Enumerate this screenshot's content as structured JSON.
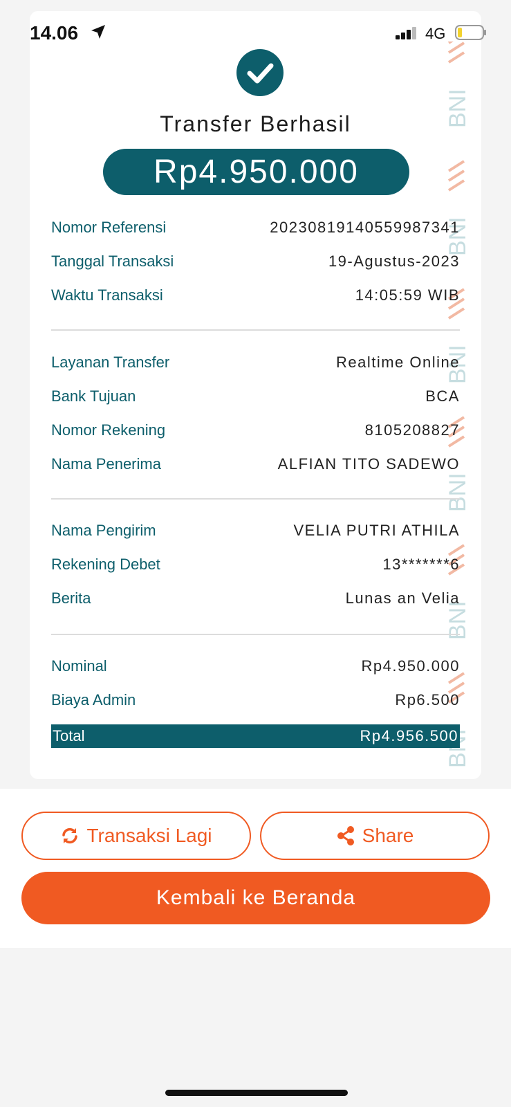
{
  "status": {
    "time": "14.06",
    "network": "4G"
  },
  "receipt": {
    "title": "Transfer Berhasil",
    "amount": "Rp4.950.000",
    "section1": [
      {
        "label": "Nomor Referensi",
        "value": "20230819140559987341"
      },
      {
        "label": "Tanggal Transaksi",
        "value": "19-Agustus-2023"
      },
      {
        "label": "Waktu Transaksi",
        "value": "14:05:59 WIB"
      }
    ],
    "section2": [
      {
        "label": "Layanan Transfer",
        "value": "Realtime Online"
      },
      {
        "label": "Bank Tujuan",
        "value": "BCA"
      },
      {
        "label": "Nomor Rekening",
        "value": "8105208827"
      },
      {
        "label": "Nama Penerima",
        "value": "ALFIAN TITO SADEWO"
      }
    ],
    "section3": [
      {
        "label": "Nama Pengirim",
        "value": "VELIA PUTRI ATHILA"
      },
      {
        "label": "Rekening Debet",
        "value": "13*******6"
      },
      {
        "label": "Berita",
        "value": "Lunas an Velia"
      }
    ],
    "section4": [
      {
        "label": "Nominal",
        "value": "Rp4.950.000"
      },
      {
        "label": "Biaya Admin",
        "value": "Rp6.500"
      }
    ],
    "total": {
      "label": "Total",
      "value": "Rp4.956.500"
    },
    "watermark_text": "BNI"
  },
  "actions": {
    "repeat_label": "Transaksi Lagi",
    "share_label": "Share",
    "home_label": "Kembali ke Beranda"
  },
  "colors": {
    "primary": "#0d5e6b",
    "accent": "#f05a22"
  },
  "icons": [
    "location-arrow-icon",
    "signal-icon",
    "battery-icon",
    "checkmark-icon",
    "refresh-icon",
    "share-icon"
  ]
}
